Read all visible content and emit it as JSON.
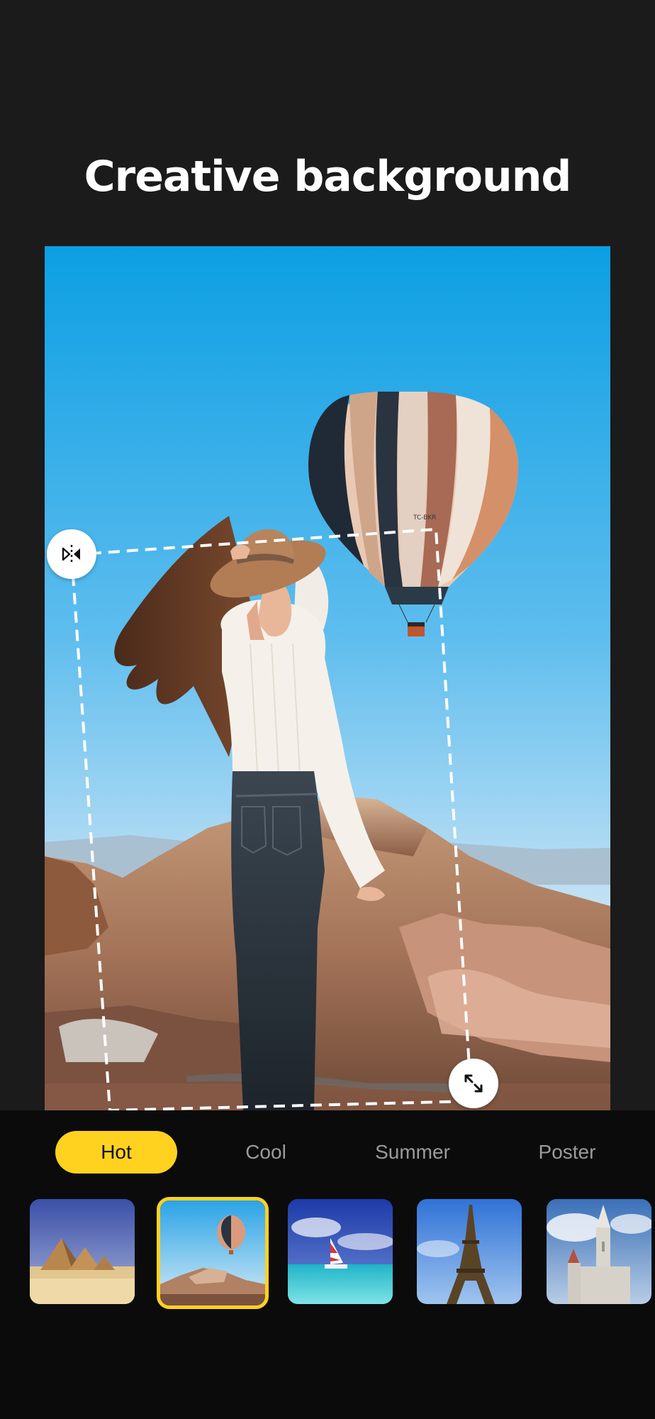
{
  "page": {
    "title": "Creative background"
  },
  "tabs": [
    {
      "label": "Hot",
      "active": true
    },
    {
      "label": "Cool",
      "active": false
    },
    {
      "label": "Summer",
      "active": false
    },
    {
      "label": "Poster",
      "active": false
    }
  ],
  "thumbnails": [
    {
      "scene": "pyramids",
      "selected": false
    },
    {
      "scene": "hot-air-balloon",
      "selected": true
    },
    {
      "scene": "sailboat-beach",
      "selected": false
    },
    {
      "scene": "eiffel-tower",
      "selected": false
    },
    {
      "scene": "cathedral",
      "selected": false
    }
  ],
  "canvas": {
    "balloon_marking": "TC-BKR",
    "handles": {
      "flip": "flip-horizontal-icon",
      "resize": "resize-arrows-icon"
    }
  },
  "colors": {
    "accent": "#ffd21f",
    "background": "#1b1b1c",
    "panel": "#0b0b0c",
    "tab_inactive": "#9b9b9b",
    "sky_top": "#0c9fe3",
    "sky_bottom": "#cfe6f5"
  }
}
